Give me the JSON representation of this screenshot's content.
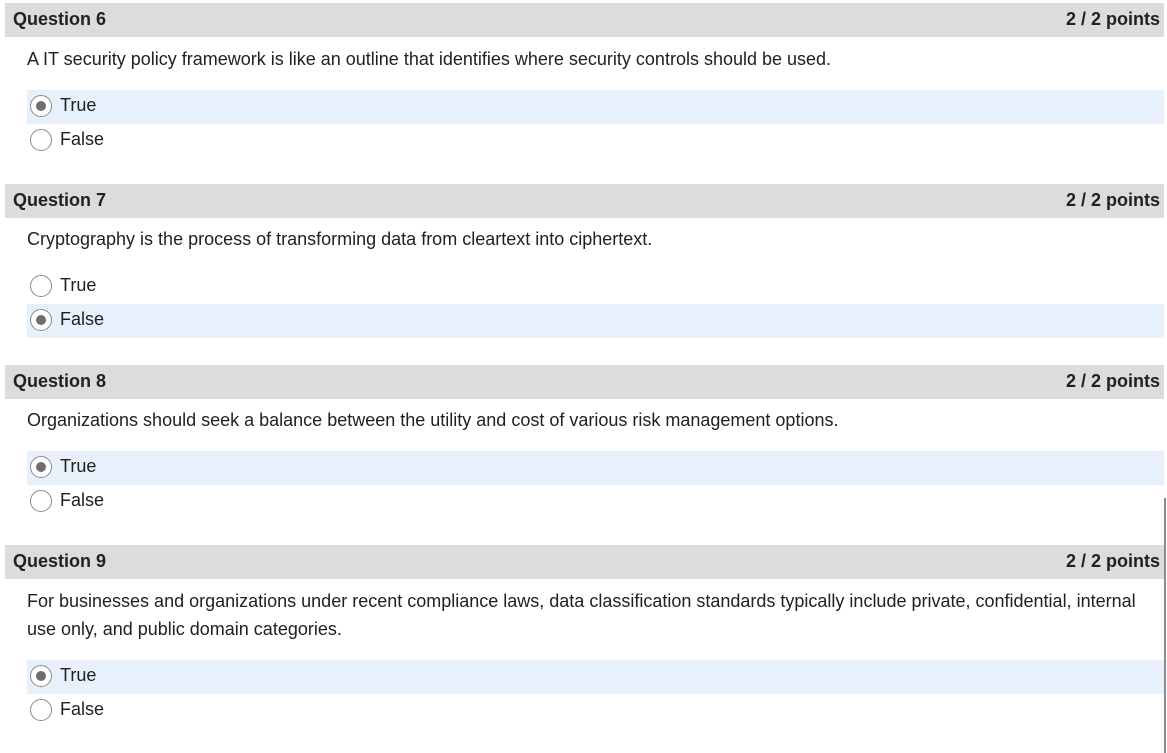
{
  "questions": [
    {
      "title": "Question 6",
      "points": "2 / 2 points",
      "text": "A IT security policy framework is like an outline that identifies where security controls should be used.",
      "options": [
        {
          "label": "True",
          "selected": true
        },
        {
          "label": "False",
          "selected": false
        }
      ]
    },
    {
      "title": "Question 7",
      "points": "2 / 2 points",
      "text": "Cryptography is the process of transforming data from cleartext into ciphertext.",
      "options": [
        {
          "label": "True",
          "selected": false
        },
        {
          "label": "False",
          "selected": true
        }
      ]
    },
    {
      "title": "Question 8",
      "points": "2 / 2 points",
      "text": "Organizations should seek a balance between the utility and cost of various risk management options.",
      "options": [
        {
          "label": "True",
          "selected": true
        },
        {
          "label": "False",
          "selected": false
        }
      ]
    },
    {
      "title": "Question 9",
      "points": "2 / 2 points",
      "text": "For businesses and organizations under recent compliance laws, data classification standards typically include private, confidential, internal use only, and public domain categories.",
      "options": [
        {
          "label": "True",
          "selected": true
        },
        {
          "label": "False",
          "selected": false
        }
      ]
    }
  ]
}
